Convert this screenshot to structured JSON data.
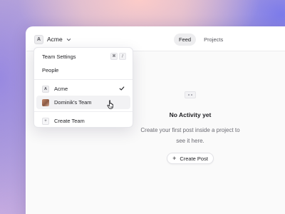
{
  "header": {
    "team_initial": "A",
    "team_name": "Acme",
    "tabs": [
      {
        "label": "Feed",
        "active": true
      },
      {
        "label": "Projects",
        "active": false
      }
    ]
  },
  "dropdown": {
    "items_top": [
      {
        "label": "Team Settings",
        "shortcut": [
          "⌘",
          "/"
        ]
      },
      {
        "label": "People"
      }
    ],
    "teams": [
      {
        "label": "Acme",
        "initial": "A",
        "selected": true,
        "icon": "letter-avatar"
      },
      {
        "label": "Dominik's Team",
        "selected": false,
        "icon": "photo-avatar"
      }
    ],
    "create_team_label": "Create Team"
  },
  "empty_state": {
    "title": "No Activity yet",
    "description": "Create your first post inside a project to see it here.",
    "button_label": "Create Post"
  },
  "icons": {
    "chevron": "chevron-down-icon",
    "check": "check-icon",
    "plus": "plus-icon",
    "cursor": "pointer-hand-icon",
    "empty": "empty-activity-icon"
  },
  "colors": {
    "accent_bg": "#ededef",
    "text": "#1f1f23",
    "muted": "#6b6b73"
  }
}
